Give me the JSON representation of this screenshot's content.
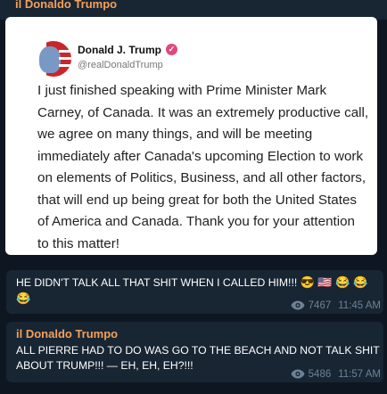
{
  "channel": {
    "name": "il Donaldo Trumpo"
  },
  "post_card": {
    "author_name": "Donald J. Trump",
    "handle": "@realDonaldTrump",
    "verified_mark": "✓",
    "text": "I just finished speaking with Prime Minister Mark Carney, of Canada. It was an extremely productive call, we agree on many things, and will be meeting immediately after Canada's upcoming Election to work on elements of Politics, Business, and all other factors, that will end up being great for both the United States of America and Canada. Thank you for your attention to this matter!"
  },
  "messages": [
    {
      "text": "HE DIDN'T TALK ALL THAT SHIT WHEN I CALLED HIM!!!",
      "emojis": "😎 🇺🇸 😂 😂 😂",
      "views": "7467",
      "time": "11:45 AM"
    },
    {
      "sender": "il Donaldo Trumpo",
      "text": "ALL PIERRE HAD TO DO WAS GO TO THE BEACH AND NOT TALK SHIT ABOUT TRUMP!!! — EH, EH, EH?!!!",
      "views": "5486",
      "time": "11:57 AM"
    }
  ],
  "colors": {
    "accent": "#f5a05a",
    "bubble": "#182533",
    "background": "#0e1621"
  }
}
